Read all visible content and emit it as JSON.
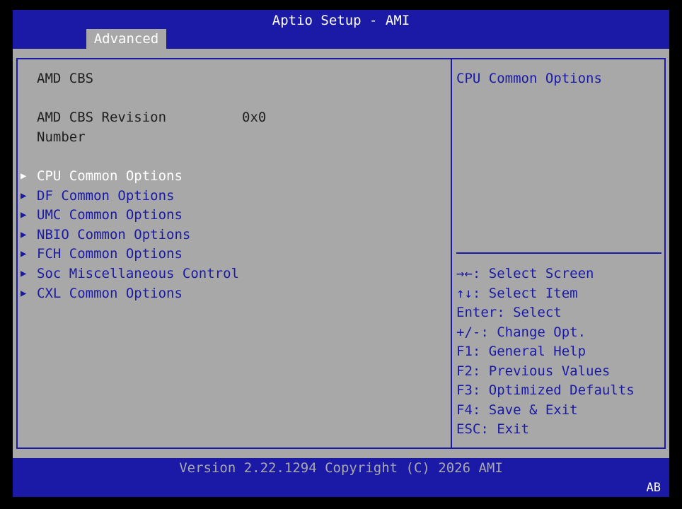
{
  "header": {
    "title": "Aptio Setup - AMI",
    "tabs": [
      {
        "label": "Advanced",
        "active": true
      }
    ]
  },
  "main": {
    "section_title": "AMD CBS",
    "revision": {
      "label_line1": "AMD CBS Revision",
      "label_line2": "Number",
      "value": "0x0"
    },
    "menu_items": [
      {
        "label": "CPU Common Options",
        "selected": true
      },
      {
        "label": "DF Common Options",
        "selected": false
      },
      {
        "label": "UMC Common Options",
        "selected": false
      },
      {
        "label": "NBIO Common Options",
        "selected": false
      },
      {
        "label": "FCH Common Options",
        "selected": false
      },
      {
        "label": "Soc Miscellaneous Control",
        "selected": false
      },
      {
        "label": "CXL Common Options",
        "selected": false
      }
    ]
  },
  "help_panel": {
    "description": "CPU Common Options",
    "keys": [
      {
        "key": "→←",
        "desc": ": Select Screen"
      },
      {
        "key": "↑↓",
        "desc": ": Select Item"
      },
      {
        "key": "Enter",
        "desc": ": Select"
      },
      {
        "key": "+/-",
        "desc": ": Change Opt."
      },
      {
        "key": "F1",
        "desc": ": General Help"
      },
      {
        "key": "F2",
        "desc": ": Previous Values"
      },
      {
        "key": "F3",
        "desc": ": Optimized Defaults"
      },
      {
        "key": "F4",
        "desc": ": Save & Exit"
      },
      {
        "key": "ESC",
        "desc": ": Exit"
      }
    ]
  },
  "footer": {
    "version": "Version 2.22.1294 Copyright (C) 2026 AMI",
    "tag": "AB"
  },
  "colors": {
    "bar_blue": "#1a1aa6",
    "panel_gray": "#a8a8a8",
    "selected_text": "#ffffff",
    "static_text": "#1f1f1f"
  },
  "icons": {
    "submenu_arrow": "triangle-right-icon"
  }
}
